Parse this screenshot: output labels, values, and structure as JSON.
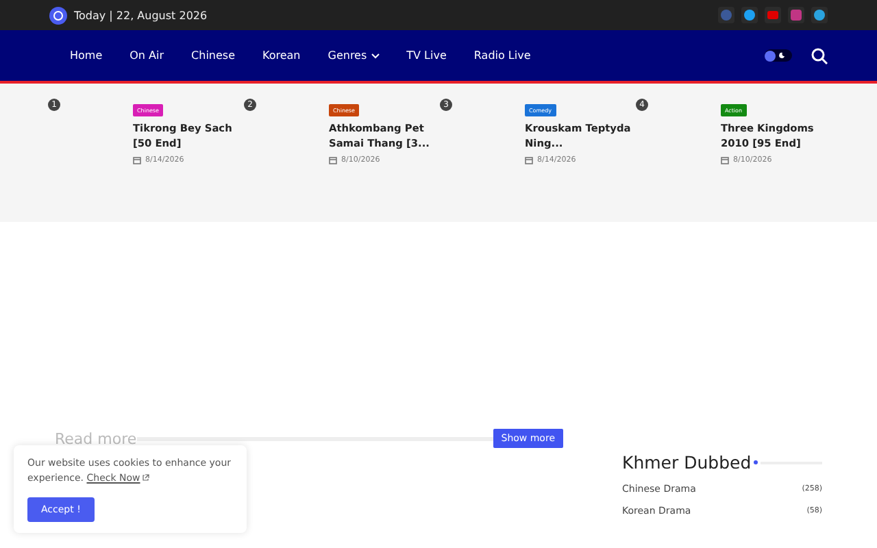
{
  "topbar": {
    "date": "Today | 22, August 2026",
    "social": [
      {
        "kind": "facebook",
        "color": "#3b5998"
      },
      {
        "kind": "twitter",
        "color": "#1da1f2"
      },
      {
        "kind": "youtube",
        "color": "#e00000"
      },
      {
        "kind": "instagram",
        "color": "#c13584"
      },
      {
        "kind": "telegram",
        "color": "#2aa3df"
      }
    ]
  },
  "nav": {
    "items": [
      {
        "label": "Home",
        "dropdown": false
      },
      {
        "label": "On Air",
        "dropdown": false
      },
      {
        "label": "Chinese",
        "dropdown": false
      },
      {
        "label": "Korean",
        "dropdown": false
      },
      {
        "label": "Genres",
        "dropdown": true
      },
      {
        "label": "TV Live",
        "dropdown": false
      },
      {
        "label": "Radio Live",
        "dropdown": false
      }
    ],
    "theme_toggle": {
      "on": false
    }
  },
  "trending": [
    {
      "number": "1",
      "tag": "Chinese",
      "color": "#d81fb5",
      "title": "Tikrong Bey Sach [50 End]",
      "date": "8/14/2026"
    },
    {
      "number": "2",
      "tag": "Chinese",
      "color": "#c8460c",
      "title": "Athkombang Pet Samai Thang [3...",
      "date": "8/10/2026"
    },
    {
      "number": "3",
      "tag": "Comedy",
      "color": "#1a73d8",
      "title": "Krouskam Teptyda Ning...",
      "date": "8/14/2026"
    },
    {
      "number": "4",
      "tag": "Action",
      "color": "#138a12",
      "title": "Three Kingdoms 2010 [95 End]",
      "date": "8/10/2026"
    }
  ],
  "section": {
    "heading": "Read more",
    "button": "Show more"
  },
  "widget": {
    "title": "Khmer Dubbed",
    "items": [
      {
        "label": "Chinese Drama",
        "count": "(258)"
      },
      {
        "label": "Korean Drama",
        "count": "(58)"
      }
    ]
  },
  "cookie": {
    "text": "Our website uses cookies to enhance your experience.",
    "link": "Check Now",
    "button": "Accept !"
  }
}
